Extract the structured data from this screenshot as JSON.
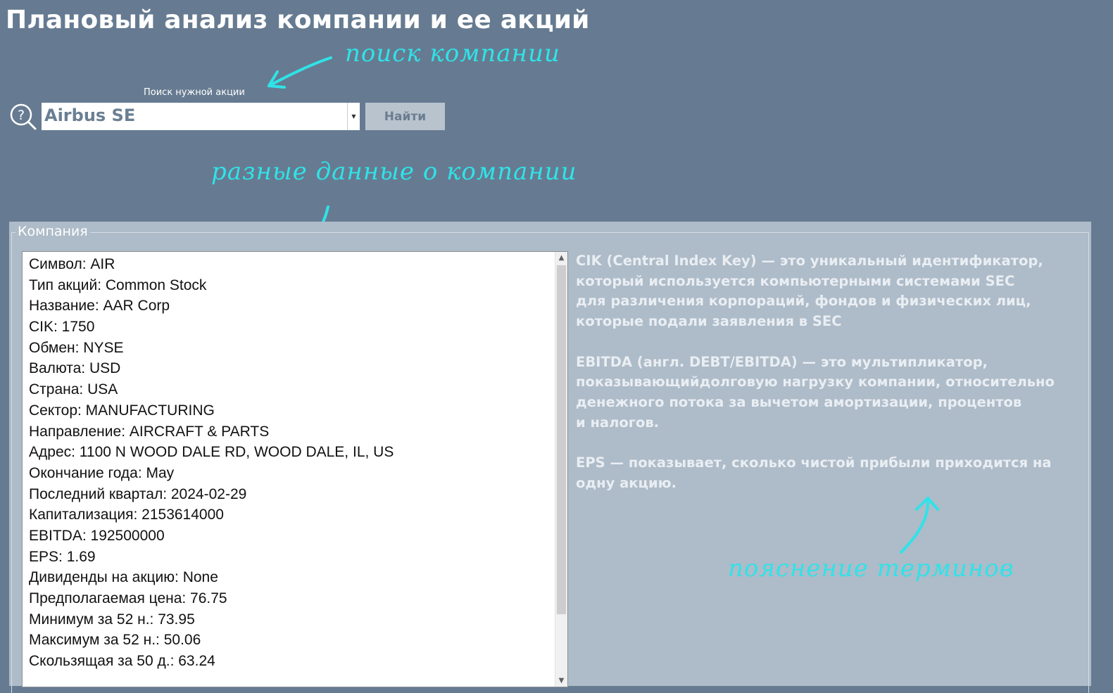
{
  "window": {
    "title": "Плановый анализ компании и ее акций"
  },
  "annotations": {
    "search": "поиск компании",
    "data": "разные данные о компании",
    "terms": "пояснение терминов"
  },
  "search": {
    "label": "Поиск нужной акции",
    "value": "Airbus SE",
    "button": "Найти",
    "icon": "search-help-icon"
  },
  "company": {
    "legend": "Компания",
    "lines": [
      "Символ: AIR",
      "Тип акций: Common Stock",
      "Название: AAR Corp",
      "CIK: 1750",
      "Обмен: NYSE",
      "Валюта: USD",
      "Страна: USA",
      "Сектор: MANUFACTURING",
      "Направление: AIRCRAFT & PARTS",
      "Адрес: 1100 N WOOD DALE RD, WOOD DALE, IL, US",
      "Окончание года: May",
      "Последний квартал: 2024-02-29",
      "Капитализация: 2153614000",
      "EBITDA: 192500000",
      "EPS: 1.69",
      "Дивиденды на акцию: None",
      "Предполагаемая цена: 76.75",
      "Минимум за 52 н.: 73.95",
      "Максимум за 52 н.: 50.06",
      "Скользящая за 50 д.: 63.24"
    ]
  },
  "glossary": [
    "CIK (Central Index Key) — это уникальный идентификатор,\nкоторый используется компьютерными системами SEC\nдля различения корпораций, фондов и физических лиц,\nкоторые подали заявления в SEC",
    "EBITDA (англ. DEBT/EBITDA) — это мультипликатор,\nпоказывающийдолговую нагрузку компании, относительно\nденежного потока за вычетом амортизации, процентов\nи налогов.",
    "EPS — показывает, сколько чистой прибыли приходится на\nодну акцию."
  ],
  "colors": {
    "background": "#667b91",
    "panel": "#aebbc8",
    "annotation": "#2fe3e8"
  }
}
